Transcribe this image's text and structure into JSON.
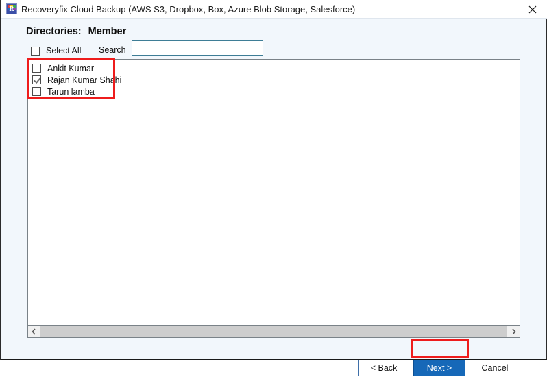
{
  "window": {
    "title": "Recoveryfix Cloud Backup (AWS S3, Dropbox, Box, Azure Blob Storage, Salesforce)",
    "icon_letter": "R",
    "close_label": "close-icon",
    "accent_blue": "#1668b8",
    "highlight_red": "#ee1c1c",
    "body_background": "#f2f7fc"
  },
  "heading": {
    "label": "Directories:",
    "value": "Member"
  },
  "toolbar": {
    "select_all_label": "Select All",
    "select_all_checked": false,
    "search_label": "Search",
    "search_value": "",
    "search_placeholder": ""
  },
  "list": {
    "items": [
      {
        "label": "Ankit Kumar",
        "checked": false
      },
      {
        "label": "Rajan Kumar Shahi",
        "checked": true
      },
      {
        "label": "Tarun lamba",
        "checked": false
      }
    ]
  },
  "scrollbar": {
    "left_arrow": "chevron-left-icon",
    "right_arrow": "chevron-right-icon"
  },
  "footer": {
    "back_label": "< Back",
    "next_label": "Next >",
    "cancel_label": "Cancel"
  }
}
